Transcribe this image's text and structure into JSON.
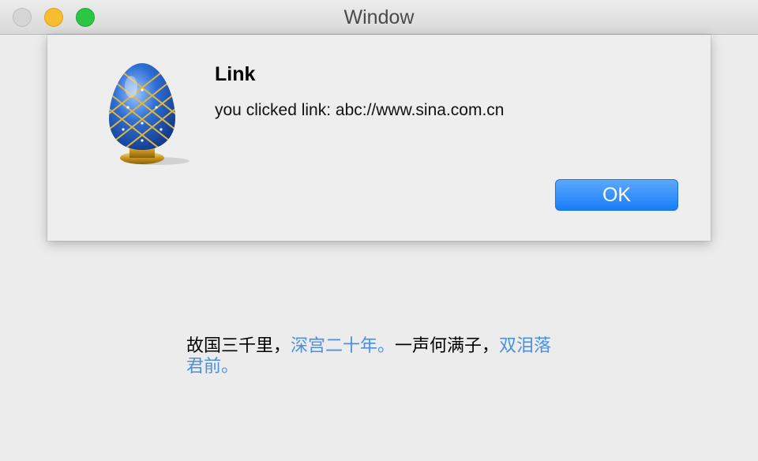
{
  "window": {
    "title": "Window"
  },
  "alert": {
    "icon": "jeweled-egg-icon",
    "title": "Link",
    "message": "you clicked link: abc://www.sina.com.cn",
    "ok_label": "OK",
    "accent_color": "#1a7cf8"
  },
  "poem": {
    "segment_1": "故国三千里，",
    "link_1": "深宫二十年。",
    "segment_2": "一声何满子，",
    "link_2": "双泪落君前。",
    "link_color": "#4a90e2"
  }
}
